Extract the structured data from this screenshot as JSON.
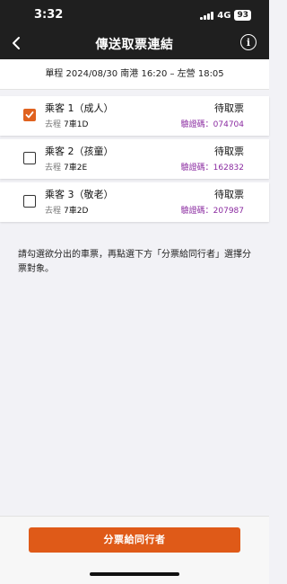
{
  "status_bar": {
    "time": "3:32",
    "network": "4G",
    "battery": "93",
    "icons": [
      "signal-icon",
      "battery-icon"
    ]
  },
  "nav": {
    "title": "傳送取票連結",
    "back_icon": "chevron-left-icon",
    "info_icon": "info-icon"
  },
  "trip": {
    "summary": "單程 2024/08/30 南港 16:20 – 左營 18:05"
  },
  "passengers": [
    {
      "name": "乘客 1（成人）",
      "direction": "去程",
      "seat": "7車1D",
      "status": "待取票",
      "code": "驗證碼：074704",
      "checked": true
    },
    {
      "name": "乘客 2（孩童）",
      "direction": "去程",
      "seat": "7車2E",
      "status": "待取票",
      "code": "驗證碼：162832",
      "checked": false
    },
    {
      "name": "乘客 3（敬老）",
      "direction": "去程",
      "seat": "7車2D",
      "status": "待取票",
      "code": "驗證碼：207987",
      "checked": false
    }
  ],
  "note": "請勾選欲分出的車票，再點選下方「分票給同行者」選擇分票對象。",
  "footer": {
    "button_label": "分票給同行者"
  },
  "colors": {
    "accent": "#df5a18",
    "header_bg": "#1f1f1f",
    "code_text": "#8a2aa0"
  }
}
